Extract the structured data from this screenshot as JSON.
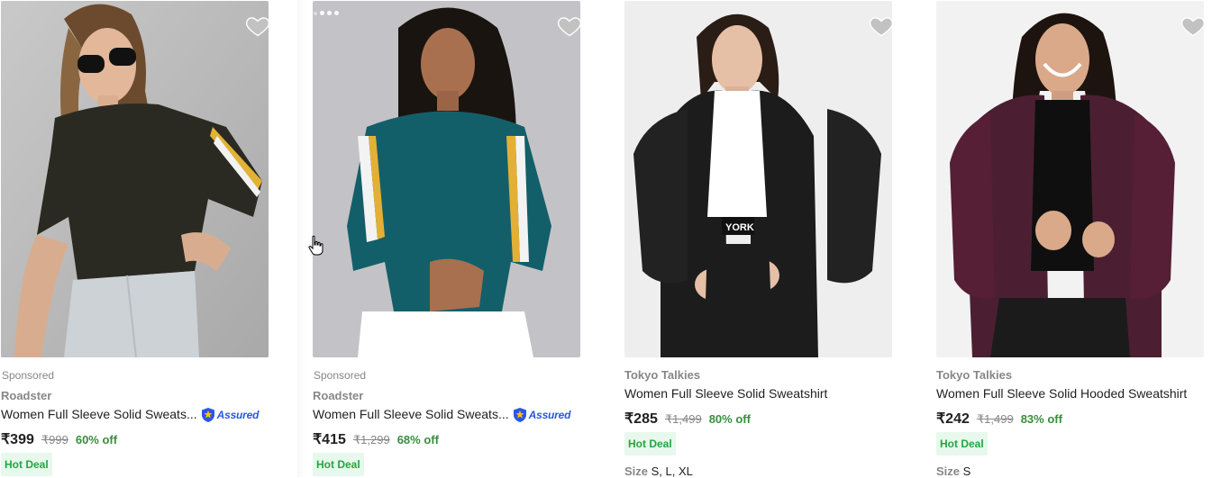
{
  "products": [
    {
      "sponsored": "Sponsored",
      "brand": "Roadster",
      "title": "Women Full Sleeve Solid Sweats...",
      "assured": "Assured",
      "price": "₹399",
      "mrp": "₹999",
      "discount": "60% off",
      "deal": "Hot Deal",
      "image": "woman in black sweatshirt with yellow striped sleeves",
      "icon": "heart-icon"
    },
    {
      "sponsored": "Sponsored",
      "brand": "Roadster",
      "title": "Women Full Sleeve Solid Sweats...",
      "assured": "Assured",
      "price": "₹415",
      "mrp": "₹1,299",
      "discount": "68% off",
      "deal": "Hot Deal",
      "image": "woman in teal sweatshirt with striped sleeves",
      "icon": "heart-icon"
    },
    {
      "brand": "Tokyo Talkies",
      "title": "Women Full Sleeve Solid Sweatshirt",
      "price": "₹285",
      "mrp": "₹1,499",
      "discount": "80% off",
      "deal": "Hot Deal",
      "size_label": "Size",
      "sizes": "S, L, XL",
      "image": "woman in black zip hoodie over white crop top",
      "icon": "heart-icon"
    },
    {
      "brand": "Tokyo Talkies",
      "title": "Women Full Sleeve Solid Hooded Sweatshirt",
      "price": "₹242",
      "mrp": "₹1,499",
      "discount": "83% off",
      "deal": "Hot Deal",
      "size_label": "Size",
      "sizes": "S",
      "image": "woman in maroon zip hoodie",
      "icon": "heart-icon"
    }
  ],
  "colors": {
    "price_text": "#212121",
    "muted": "#878787",
    "discount_green": "#388e3c",
    "deal_bg": "#e7f8ec",
    "deal_text": "#26a541",
    "assured_blue": "#2a55e5",
    "wishlist_gray": "#c2c2c2"
  }
}
